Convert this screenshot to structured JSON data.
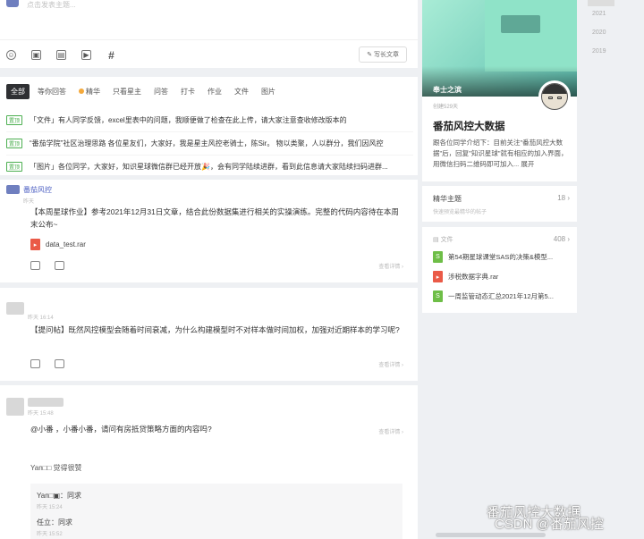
{
  "composer": {
    "placeholder": "点击发表主题...",
    "long_post": "写长文章"
  },
  "tabs": [
    "全部",
    "等你回答",
    "精华",
    "只看星主",
    "问答",
    "打卡",
    "作业",
    "文件",
    "图片"
  ],
  "pins": [
    {
      "badge": "置顶",
      "text": "「文件」有人同学反馈，excel里表中的问题，我顺便做了检查在此上传，请大家注意查收修改版本的"
    },
    {
      "badge": "置顶",
      "text": "“番茄学院”社区治理思路 各位星友们，大家好，我是星主风控老骑士，陈Sir。 物以类聚，人以群分，我们因风控"
    },
    {
      "badge": "置顶",
      "text": "「图片」各位同学，大家好，知识星球微信群已经开放🎉，会有同学陆续进群，看到此信息请大家陆续扫码进群..."
    }
  ],
  "post1": {
    "author": "番茄风控",
    "time": "昨天",
    "body": "【本周星球作业】参考2021年12月31日文章，结合此份数据集进行相关的实操演练。完整的代码内容待在本周末公布~",
    "file": "data_test.rar",
    "detail": "查看详情 ›"
  },
  "post2": {
    "time": "昨天 16:14",
    "body": "【提问帖】既然风控模型会随着时间衰减，为什么构建模型时不对样本做时间加权，加强对近期样本的学习呢?",
    "detail": "查看详情 ›"
  },
  "post3": {
    "time": "昨天 15:48",
    "body": "@小番 ，小番小番，请问有房抵贷策略方面的内容吗?",
    "liked": "Yan□□ 觉得很赞",
    "detail": "查看详情 ›",
    "replies": [
      {
        "who": "Yan□▣：同求",
        "time": "昨天 15:24"
      },
      {
        "who": "任立：同求",
        "time": "昨天 15:52"
      }
    ]
  },
  "group": {
    "owner": "奉士之滨",
    "created": "创建529天",
    "name": "番茄风控大数据",
    "desc": "跟各位同学介绍下：目前关注\"番茄风控大数据\"后，回复\"知识星球\"就有相应的加入界面，用微信扫码二维码即可加入... 展开"
  },
  "featured": {
    "label": "精华主题",
    "count": "18 ›",
    "sub": "快速预览最精华的帖子"
  },
  "files": {
    "label": "文件",
    "count": "408 ›",
    "items": [
      {
        "type": "xls",
        "name": "第54期星球课堂SAS的决策&模型..."
      },
      {
        "type": "pdf",
        "name": "涉税数据字典.rar"
      },
      {
        "type": "xls",
        "name": "一周监管动态汇总2021年12月第5..."
      }
    ]
  },
  "years": [
    "2021",
    "2020",
    "2019"
  ],
  "watermark": {
    "line1": "番茄风控大数据",
    "line2": "CSDN @番茄风控"
  },
  "colors": {
    "accent": "#4b5ec2",
    "active_tab": "#2f3033",
    "pin_badge": "#4caf50"
  }
}
